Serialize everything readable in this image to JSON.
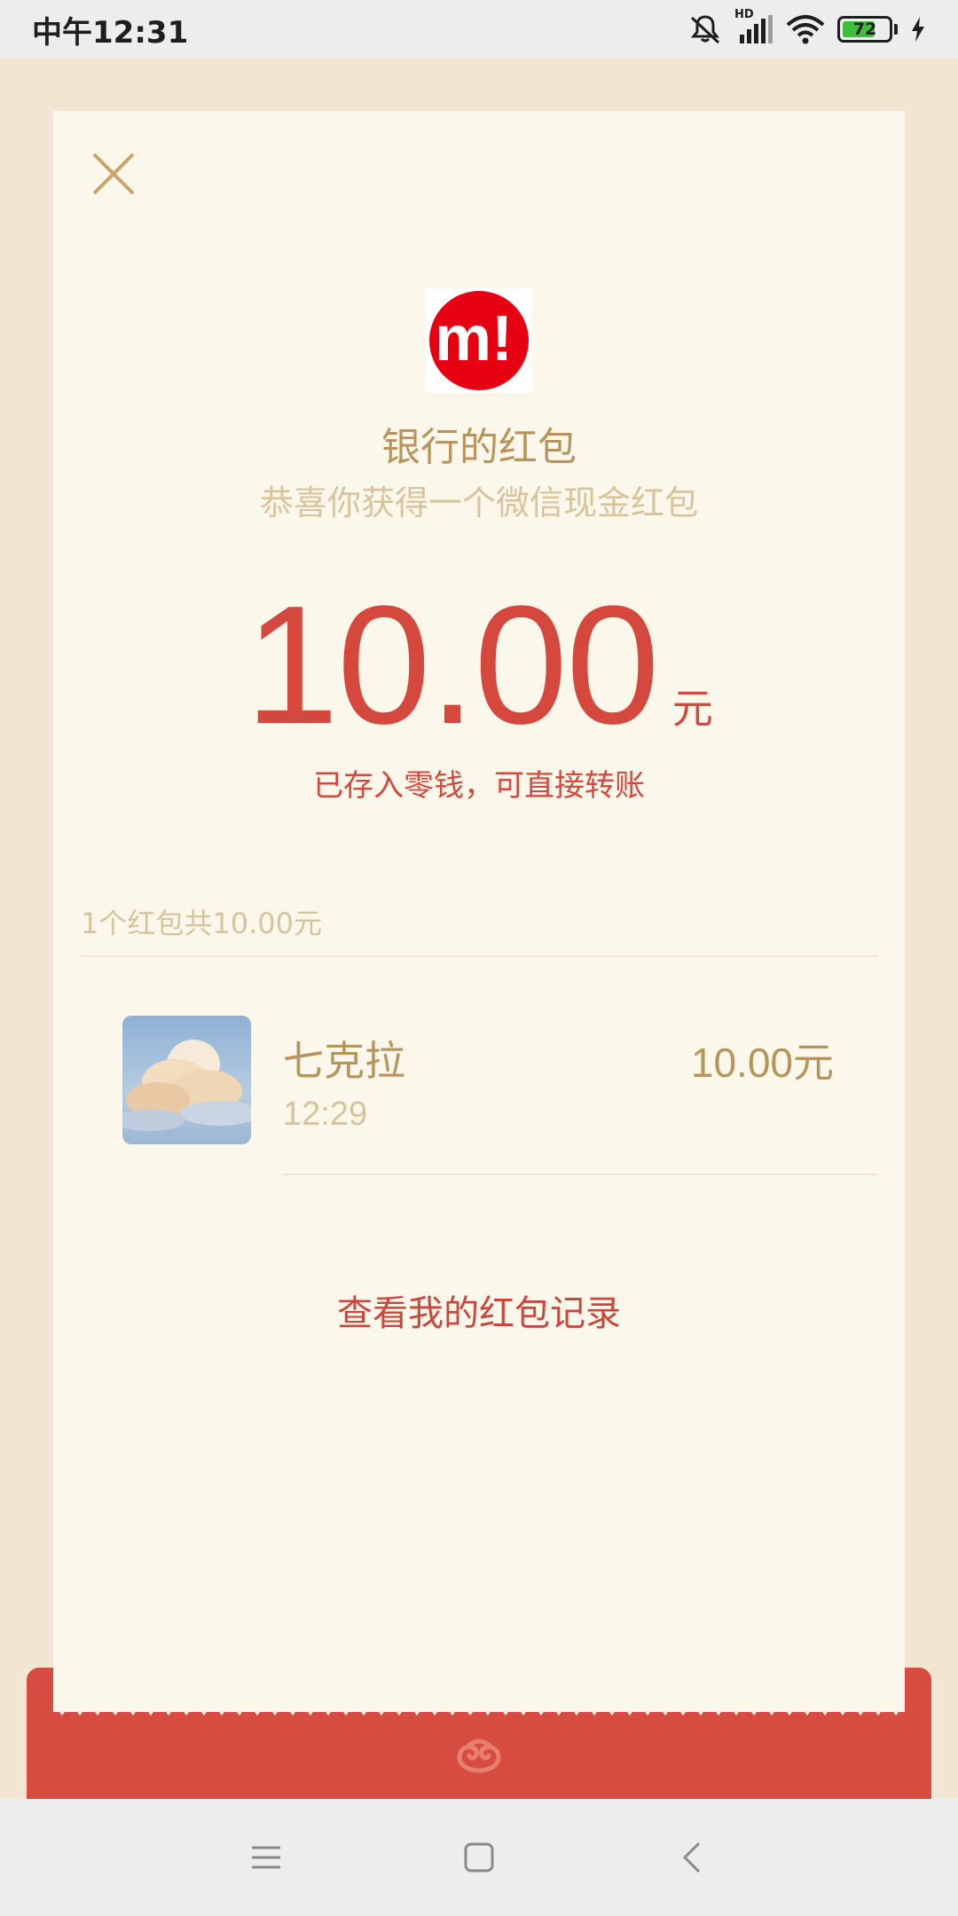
{
  "status_bar": {
    "time": "中午12:31",
    "network_label": "HD",
    "battery_level": "72"
  },
  "envelope": {
    "close_icon": "close-icon",
    "logo_text": "m!",
    "logo_color": "#E60012",
    "sender_title": "银行的红包",
    "greeting": "恭喜你获得一个微信现金红包",
    "amount": "10.00",
    "amount_unit": "元",
    "amount_note": "已存入零钱，可直接转账",
    "summary": "1个红包共10.00元",
    "recipients": [
      {
        "name": "七克拉",
        "time": "12:29",
        "amount": "10.00元"
      }
    ],
    "history_link": "查看我的红包记录"
  },
  "nav_bar": {
    "menu_icon": "menu-icon",
    "home_icon": "home-icon",
    "back_icon": "back-icon"
  },
  "colors": {
    "accent_red": "#D5483D",
    "gold_text": "#B7955A",
    "muted_gold": "#D8C49C",
    "card_bg": "#FCF7EB",
    "page_bg": "#F0E6D2"
  }
}
